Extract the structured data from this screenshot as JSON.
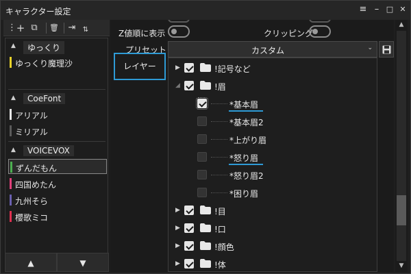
{
  "window": {
    "title": "キャラクター設定"
  },
  "window_controls": {
    "menu": "≡",
    "minimize": "–",
    "maximize": "□",
    "close": "✕"
  },
  "toolbar": {
    "more": "⋮",
    "add": "+",
    "copy": "⧉",
    "delete": "🗑",
    "import": "⇥",
    "sort": "⇅"
  },
  "groups": [
    {
      "name": "ゆっくり",
      "characters": [
        {
          "name": "ゆっくり魔理沙",
          "color": "#e8d22a"
        }
      ]
    },
    {
      "name": "CoeFont",
      "characters": [
        {
          "name": "アリアル",
          "color": "#e8e8e8"
        },
        {
          "name": "ミリアル",
          "color": "#5a5a5a"
        }
      ]
    },
    {
      "name": "VOICEVOX",
      "characters": [
        {
          "name": "ずんだもん",
          "color": "#4caf50",
          "selected": true
        },
        {
          "name": "四国めたん",
          "color": "#e0407a"
        },
        {
          "name": "九州そら",
          "color": "#6a60b0"
        },
        {
          "name": "櫻歌ミコ",
          "color": "#e03050"
        }
      ]
    }
  ],
  "nav": {
    "up": "▲",
    "down": "▼"
  },
  "settings": {
    "z_order_label": "Z値順に表示",
    "clipping_label": "クリッピング",
    "preset_label": "プリセット",
    "preset_value": "カスタム",
    "layer_tab": "レイヤー"
  },
  "layers": [
    {
      "name": "!記号など",
      "level": 0,
      "checked": true,
      "folder": true,
      "expanded": false
    },
    {
      "name": "!眉",
      "level": 0,
      "checked": true,
      "folder": true,
      "expanded": true
    },
    {
      "name": "*基本眉",
      "level": 1,
      "checked": true,
      "folder": false,
      "underline": true,
      "focus": true
    },
    {
      "name": "*基本眉2",
      "level": 1,
      "checked": false,
      "folder": false
    },
    {
      "name": "*上がり眉",
      "level": 1,
      "checked": false,
      "folder": false
    },
    {
      "name": "*怒り眉",
      "level": 1,
      "checked": false,
      "folder": false,
      "underline": true
    },
    {
      "name": "*怒り眉2",
      "level": 1,
      "checked": false,
      "folder": false
    },
    {
      "name": "*困り眉",
      "level": 1,
      "checked": false,
      "folder": false
    },
    {
      "name": "!目",
      "level": 0,
      "checked": true,
      "folder": true,
      "expanded": false
    },
    {
      "name": "!口",
      "level": 0,
      "checked": true,
      "folder": true,
      "expanded": false
    },
    {
      "name": "!顔色",
      "level": 0,
      "checked": true,
      "folder": true,
      "expanded": false
    },
    {
      "name": "!体",
      "level": 0,
      "checked": true,
      "folder": true,
      "expanded": false
    }
  ],
  "colors": {
    "accent": "#2e9bd6"
  }
}
